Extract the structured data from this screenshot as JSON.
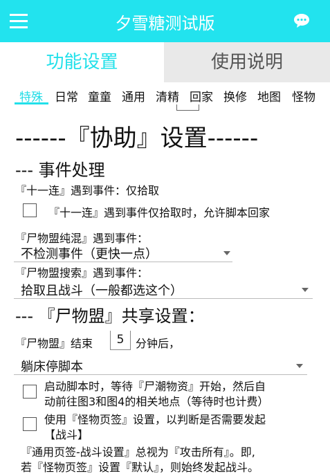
{
  "appbar": {
    "title": "夕雪糖测试版",
    "menu_icon": "hamburger-menu-icon",
    "chat_icon": "chat-bubble-icon",
    "color": "#22e3ee"
  },
  "tabs": [
    {
      "label": "功能设置",
      "active": true
    },
    {
      "label": "使用说明",
      "active": false
    }
  ],
  "subtabs": [
    "特殊",
    "日常",
    "童童",
    "通用",
    "清精",
    "回家",
    "换修",
    "地图",
    "怪物"
  ],
  "content": {
    "main_heading": "------『协助』设置------",
    "section1": "--- 事件处理",
    "line1": "『十一连』遇到事件：仅拾取",
    "checkbox1_label": "『十一连』遇到事件仅拾取时，允许脚本回家",
    "label2": "『尸物盟纯混』遇到事件：",
    "select1_value": "不检测事件（更快一点）",
    "label3": "『尸物盟搜索』遇到事件：",
    "select2_value": "拾取且战斗（一般都选这个）",
    "section2": "--- 『尸物盟』共享设置：",
    "end_prefix": "『尸物盟』结束",
    "end_value": "5",
    "end_suffix": "分钟后，",
    "select3_value": "躺床停脚本",
    "checkbox2_line1": "启动脚本时，等待『尸潮物资』开始，然后自",
    "checkbox2_line2": "动前往图3和图4的相关地点（等待时也计费）",
    "checkbox3_line1": "使用『怪物页签』设置，以判断是否需要发起",
    "checkbox3_line2": "【战斗】",
    "note_line1": "『通用页签-战斗设置』总视为『攻击所有』。即,",
    "note_line2": "若『怪物页签』设置『默认』，则始终发起战斗。"
  }
}
